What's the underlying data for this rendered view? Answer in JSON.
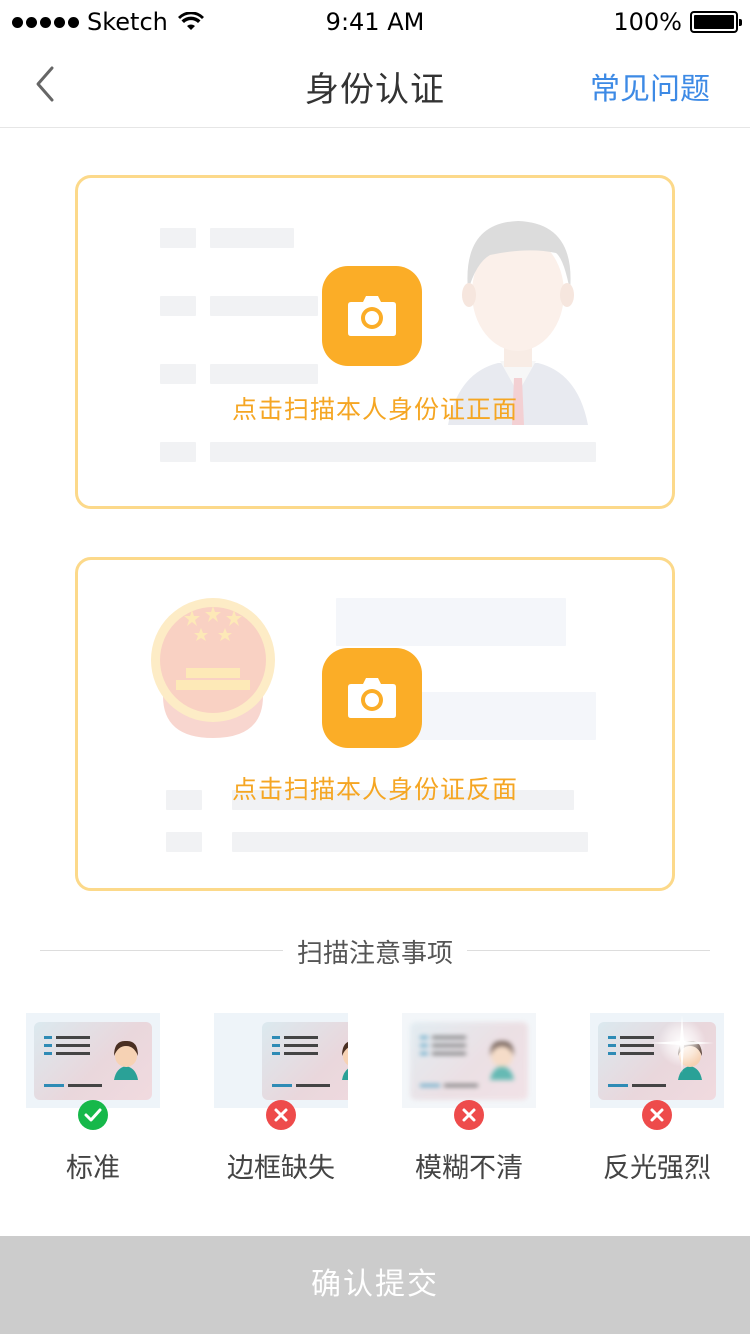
{
  "status_bar": {
    "carrier": "Sketch",
    "time": "9:41 AM",
    "battery": "100%"
  },
  "nav": {
    "title": "身份认证",
    "faq_link": "常见问题",
    "back_icon": "chevron-left-icon"
  },
  "scan_front": {
    "label": "点击扫描本人身份证正面",
    "icon": "camera-icon"
  },
  "scan_back": {
    "label": "点击扫描本人身份证反面",
    "icon": "camera-icon"
  },
  "tips": {
    "title": "扫描注意事项",
    "items": [
      {
        "label": "标准",
        "status": "ok"
      },
      {
        "label": "边框缺失",
        "status": "bad"
      },
      {
        "label": "模糊不清",
        "status": "bad"
      },
      {
        "label": "反光强烈",
        "status": "bad"
      }
    ]
  },
  "submit": {
    "label": "确认提交"
  },
  "colors": {
    "accent": "#fbad27",
    "label_orange": "#f5a623",
    "link_blue": "#3d8ae5",
    "card_border": "#fcd98a",
    "ok_green": "#16b84a",
    "error_red": "#ee4b4b",
    "submit_disabled": "#cccccc"
  }
}
